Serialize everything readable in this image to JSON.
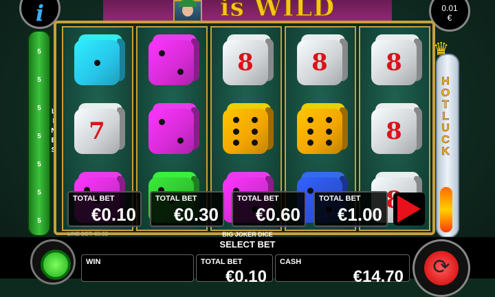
{
  "header": {
    "title_text": "is WILD",
    "info_label": "i",
    "coin_value": "0.01",
    "coin_currency": "€"
  },
  "lines": {
    "label": "LINES",
    "counts": [
      "5",
      "5",
      "5",
      "5",
      "5",
      "5",
      "5"
    ]
  },
  "meter": {
    "label": "HOT LUCK",
    "fill_level": 0.26
  },
  "reels": [
    [
      {
        "type": "pips",
        "pips": 1,
        "color": "#27c6ea"
      },
      {
        "type": "number",
        "text": "7",
        "color": "#cfd3d6"
      },
      {
        "type": "pips",
        "pips": 3,
        "color": "#d62bd6"
      }
    ],
    [
      {
        "type": "pips",
        "pips": 2,
        "color": "#d62bd6"
      },
      {
        "type": "pips",
        "pips": 2,
        "color": "#d62bd6"
      },
      {
        "type": "pips",
        "pips": 3,
        "color": "#2fc42f"
      }
    ],
    [
      {
        "type": "number",
        "text": "8",
        "color": "#cfd3d6"
      },
      {
        "type": "pips",
        "pips": 6,
        "color": "#f2a500"
      },
      {
        "type": "pips",
        "pips": 2,
        "color": "#d62bd6"
      }
    ],
    [
      {
        "type": "number",
        "text": "8",
        "color": "#cfd3d6"
      },
      {
        "type": "pips",
        "pips": 6,
        "color": "#f2a500"
      },
      {
        "type": "pips",
        "pips": 2,
        "color": "#2a52d9"
      }
    ],
    [
      {
        "type": "number",
        "text": "8",
        "color": "#cfd3d6"
      },
      {
        "type": "number",
        "text": "8",
        "color": "#cfd3d6"
      },
      {
        "type": "number",
        "text": "8",
        "color": "#cfd3d6"
      }
    ]
  ],
  "bet_options": [
    {
      "label": "TOTAL BET",
      "value": "€0.10"
    },
    {
      "label": "TOTAL BET",
      "value": "€0.30"
    },
    {
      "label": "TOTAL BET",
      "value": "€0.60"
    },
    {
      "label": "TOTAL BET",
      "value": "€1.00"
    }
  ],
  "line_bet": "LINE BET: €0.02",
  "game_name": "BIG JOKER DICE",
  "select_bet": "SELECT BET",
  "bottom": {
    "win_label": "WIN",
    "win_value": "",
    "total_bet_label": "TOTAL BET",
    "total_bet_value": "€0.10",
    "cash_label": "CASH",
    "cash_value": "€14.70"
  }
}
